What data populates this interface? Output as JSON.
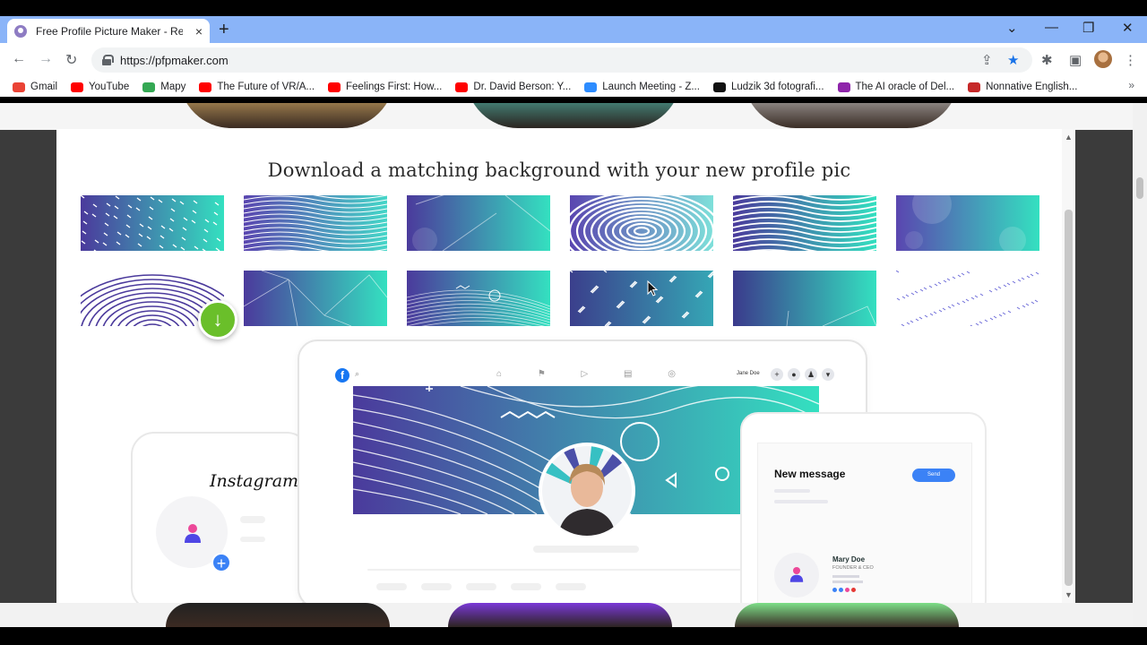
{
  "browser": {
    "tab_title": "Free Profile Picture Maker - Resu",
    "url": "https://pfpmaker.com",
    "new_tab": "+",
    "close_tab": "×",
    "back": "←",
    "forward": "→",
    "reload": "↻",
    "bookmarks": [
      {
        "label": "Gmail",
        "color": "#ea4335"
      },
      {
        "label": "YouTube",
        "color": "#ff0000"
      },
      {
        "label": "Mapy",
        "color": "#34a853"
      },
      {
        "label": "The Future of VR/A...",
        "color": "#ff0000"
      },
      {
        "label": "Feelings First: How...",
        "color": "#ff0000"
      },
      {
        "label": "Dr. David Berson: Y...",
        "color": "#ff0000"
      },
      {
        "label": "Launch Meeting - Z...",
        "color": "#2d8cff"
      },
      {
        "label": "Ludzik 3d fotografi...",
        "color": "#111111"
      },
      {
        "label": "The AI oracle of Del...",
        "color": "#8e24aa"
      },
      {
        "label": "Nonnative English...",
        "color": "#c62828"
      }
    ],
    "more_bookmarks": "»"
  },
  "modal": {
    "title": "Download a matching background with your new profile pic",
    "backgrounds": [
      {
        "name": "bg-confetti-purple-teal"
      },
      {
        "name": "bg-maze-lines-purple"
      },
      {
        "name": "bg-geometric-teal"
      },
      {
        "name": "bg-swirl-waves-purple"
      },
      {
        "name": "bg-wavy-lines-purple"
      },
      {
        "name": "bg-bokeh-teal"
      },
      {
        "name": "bg-concentric-arcs"
      },
      {
        "name": "bg-polygon-purple-teal"
      },
      {
        "name": "bg-lines-shapes-teal"
      },
      {
        "name": "bg-memphis-dark"
      },
      {
        "name": "bg-gradient-plain"
      },
      {
        "name": "bg-doodle-white"
      }
    ],
    "download_icon": "↓"
  },
  "mockups": {
    "instagram_label": "Instagram",
    "instagram_plus": "+",
    "facebook_logo": "f",
    "facebook_user": "Jane Doe",
    "message_title": "New message",
    "message_send": "Send",
    "message_name": "Mary Doe",
    "message_role": "FOUNDER & CEO"
  },
  "colors": {
    "accent_blue": "#3b82f6",
    "download_green": "#6abf2a",
    "gradient_start": "#3b2f8f",
    "gradient_end": "#34e0c0"
  }
}
